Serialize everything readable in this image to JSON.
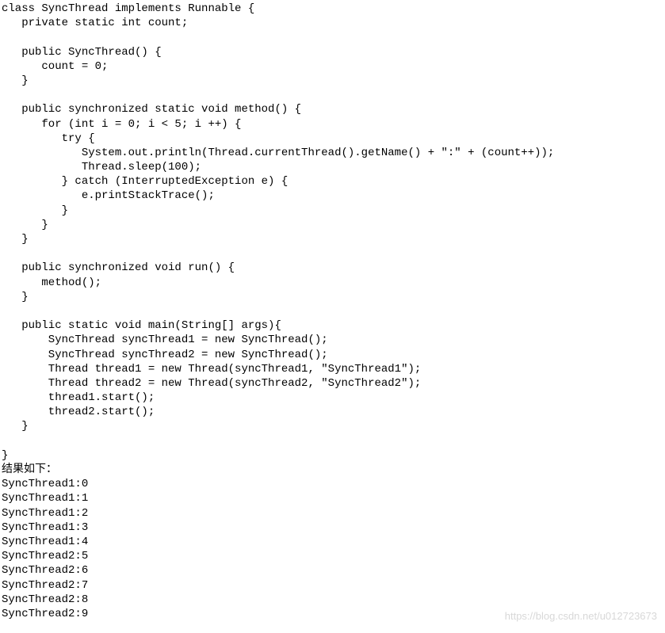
{
  "code": {
    "lines": [
      "class SyncThread implements Runnable {",
      "   private static int count;",
      "",
      "   public SyncThread() {",
      "      count = 0;",
      "   }",
      "",
      "   public synchronized static void method() {",
      "      for (int i = 0; i < 5; i ++) {",
      "         try {",
      "            System.out.println(Thread.currentThread().getName() + \":\" + (count++));",
      "            Thread.sleep(100);",
      "         } catch (InterruptedException e) {",
      "            e.printStackTrace();",
      "         }",
      "      }",
      "   }",
      "",
      "   public synchronized void run() {",
      "      method();",
      "   }",
      "",
      "   public static void main(String[] args){",
      "       SyncThread syncThread1 = new SyncThread();",
      "       SyncThread syncThread2 = new SyncThread();",
      "       Thread thread1 = new Thread(syncThread1, \"SyncThread1\");",
      "       Thread thread2 = new Thread(syncThread2, \"SyncThread2\");",
      "       thread1.start();",
      "       thread2.start();",
      "   }",
      "",
      "}"
    ]
  },
  "output": {
    "label": "结果如下：",
    "lines": [
      "SyncThread1:0",
      "SyncThread1:1",
      "SyncThread1:2",
      "SyncThread1:3",
      "SyncThread1:4",
      "SyncThread2:5",
      "SyncThread2:6",
      "SyncThread2:7",
      "SyncThread2:8",
      "SyncThread2:9"
    ]
  },
  "watermark": "https://blog.csdn.net/u012723673"
}
